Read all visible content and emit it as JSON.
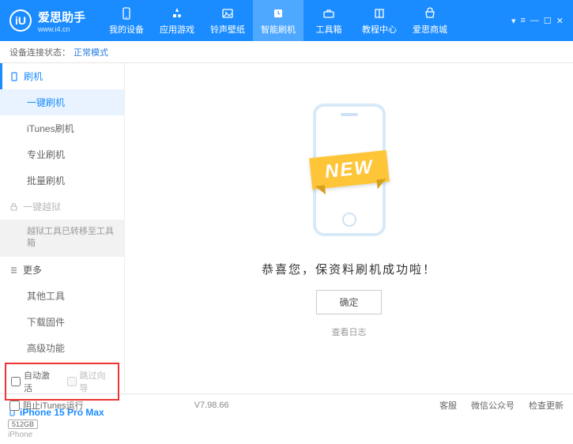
{
  "brand": {
    "name": "爱思助手",
    "url": "www.i4.cn",
    "logo_letters": "iU"
  },
  "nav": [
    {
      "label": "我的设备"
    },
    {
      "label": "应用游戏"
    },
    {
      "label": "铃声壁纸"
    },
    {
      "label": "智能刷机"
    },
    {
      "label": "工具箱"
    },
    {
      "label": "教程中心"
    },
    {
      "label": "爱思商城"
    }
  ],
  "status": {
    "label": "设备连接状态：",
    "mode": "正常模式"
  },
  "sidebar": {
    "flash_header": "刷机",
    "flash_items": [
      "一键刷机",
      "iTunes刷机",
      "专业刷机",
      "批量刷机"
    ],
    "jailbreak_header": "一键越狱",
    "jailbreak_note": "越狱工具已转移至工具箱",
    "more_header": "更多",
    "more_items": [
      "其他工具",
      "下载固件",
      "高级功能"
    ],
    "auto_activate": "自动激活",
    "skip_guide": "跳过向导"
  },
  "device": {
    "name": "iPhone 15 Pro Max",
    "storage": "512GB",
    "type": "iPhone"
  },
  "main": {
    "ribbon": "NEW",
    "success": "恭喜您，保资料刷机成功啦！",
    "ok": "确定",
    "viewlog": "查看日志"
  },
  "footer": {
    "block_itunes": "阻止iTunes运行",
    "version": "V7.98.66",
    "links": [
      "客服",
      "微信公众号",
      "检查更新"
    ]
  }
}
